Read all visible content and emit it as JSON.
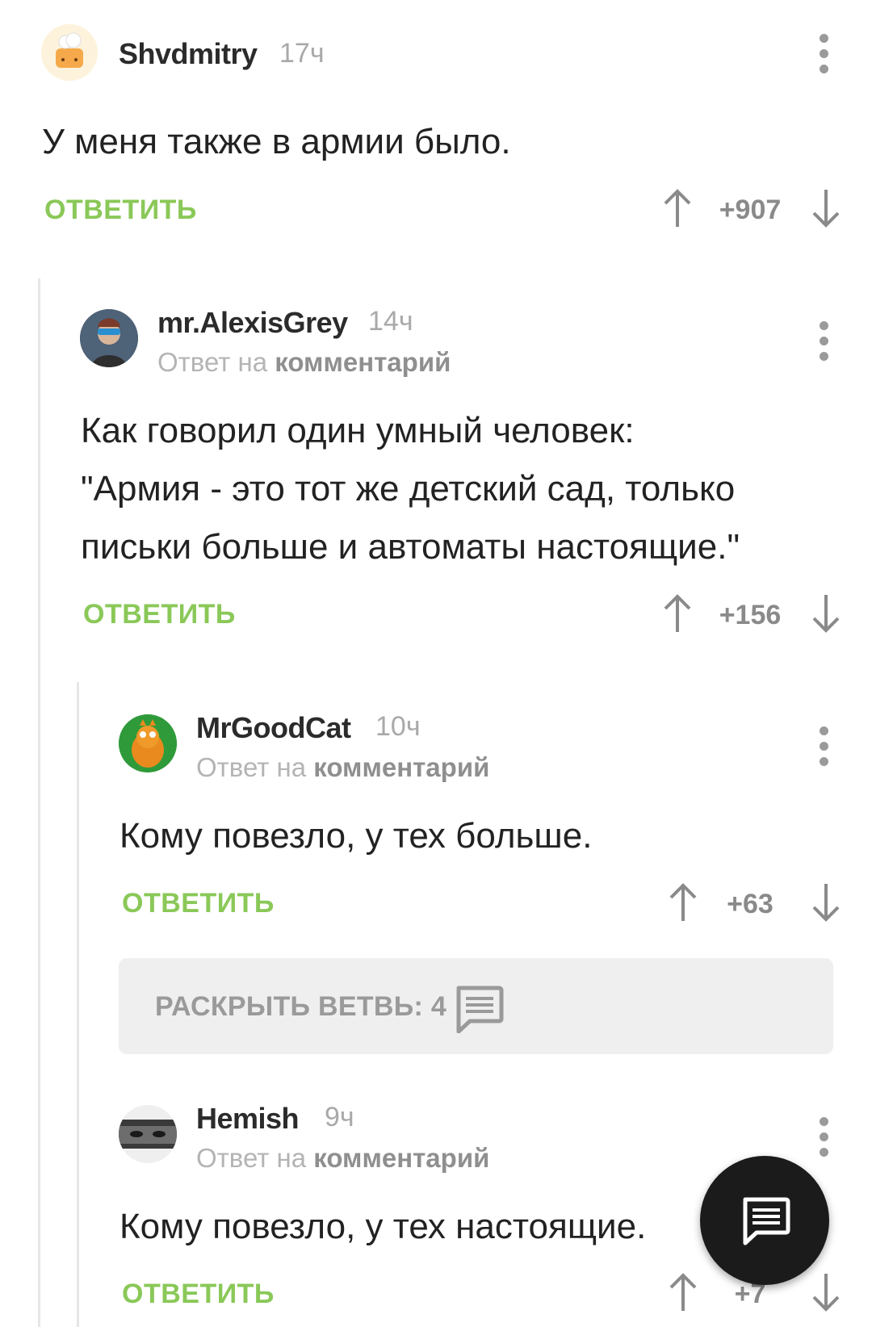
{
  "comments": [
    {
      "author": "Shvdmitry",
      "time": "17ч",
      "text": "У меня также в армии было.",
      "reply_label": "ОТВЕТИТЬ",
      "score": "+907"
    },
    {
      "author": "mr.AlexisGrey",
      "time": "14ч",
      "reply_to_prefix": "Ответ на",
      "reply_to_link": "комментарий",
      "text_lines": [
        "Как говорил один умный человек:",
        "\"Армия - это тот же детский сад, только",
        "письки больше и автоматы настоящие.\""
      ],
      "reply_label": "ОТВЕТИТЬ",
      "score": "+156"
    },
    {
      "author": "MrGoodCat",
      "time": "10ч",
      "reply_to_prefix": "Ответ на",
      "reply_to_link": "комментарий",
      "text": "Кому повезло, у тех больше.",
      "reply_label": "ОТВЕТИТЬ",
      "score": "+63"
    },
    {
      "author": "Hemish",
      "time": "9ч",
      "reply_to_prefix": "Ответ на",
      "reply_to_link": "комментарий",
      "text": "Кому повезло, у тех настоящие.",
      "reply_label": "ОТВЕТИТЬ",
      "score": "+7"
    }
  ],
  "expand_branch": {
    "label": "РАСКРЫТЬ ВЕТВЬ: 4",
    "icon": "comment-icon"
  },
  "fab": {
    "icon": "comment-icon"
  },
  "colors": {
    "accent_green": "#8ac858",
    "fab_bg": "#1b1b1b"
  }
}
